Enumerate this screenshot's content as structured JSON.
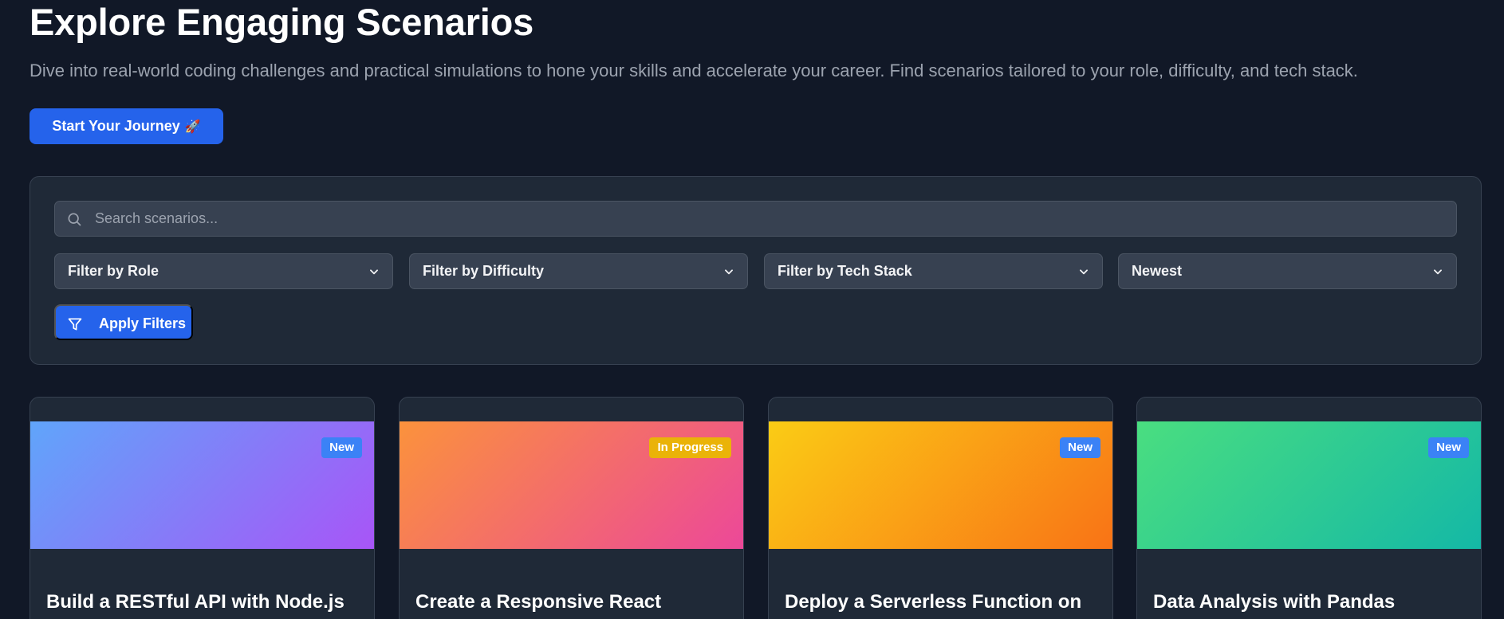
{
  "hero": {
    "title": "Explore Engaging Scenarios",
    "subtitle": "Dive into real-world coding challenges and practical simulations to hone your skills and accelerate your career. Find scenarios tailored to your role, difficulty, and tech stack.",
    "cta_label": "Start Your Journey",
    "cta_emoji": "🚀"
  },
  "filters": {
    "search_placeholder": "Search scenarios...",
    "selects": [
      {
        "label": "Filter by Role"
      },
      {
        "label": "Filter by Difficulty"
      },
      {
        "label": "Filter by Tech Stack"
      },
      {
        "label": "Newest"
      }
    ],
    "apply_label": "Apply Filters"
  },
  "cards": [
    {
      "title": "Build a RESTful API with Node.js",
      "badge": "New",
      "badge_color": "#3b82f6",
      "gradient": [
        "#60a5fa",
        "#a855f7"
      ]
    },
    {
      "title": "Create a Responsive React",
      "badge": "In Progress",
      "badge_color": "#eab308",
      "gradient": [
        "#fb923c",
        "#ec4899"
      ]
    },
    {
      "title": "Deploy a Serverless Function on",
      "badge": "New",
      "badge_color": "#3b82f6",
      "gradient": [
        "#facc15",
        "#f97316"
      ]
    },
    {
      "title": "Data Analysis with Pandas",
      "badge": "New",
      "badge_color": "#3b82f6",
      "gradient": [
        "#4ade80",
        "#14b8a6"
      ]
    }
  ],
  "colors": {
    "background": "#111827",
    "panel": "#1f2937",
    "accent": "#2563eb"
  }
}
